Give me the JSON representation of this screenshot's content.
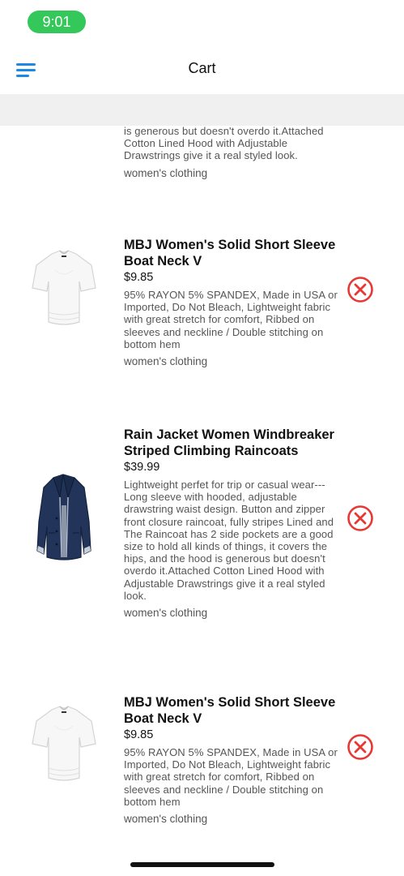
{
  "status_bar": {
    "time": "9:01"
  },
  "nav": {
    "title": "Cart",
    "menu_icon": "hamburger-icon"
  },
  "partial_item": {
    "description_tail": "is generous but doesn't overdo it.Attached Cotton Lined Hood with Adjustable Drawstrings give it a real styled look.",
    "category": "women's clothing"
  },
  "items": [
    {
      "name": "MBJ Women's Solid Short Sleeve Boat Neck V",
      "price": "$9.85",
      "description": "95% RAYON 5% SPANDEX, Made in USA or Imported, Do Not Bleach, Lightweight fabric with great stretch for comfort, Ribbed on sleeves and neckline / Double stitching on bottom hem",
      "category": "women's clothing",
      "image": "white-tshirt"
    },
    {
      "name": "Rain Jacket Women Windbreaker Striped Climbing Raincoats",
      "price": "$39.99",
      "description": "Lightweight perfet for trip or casual wear---Long sleeve with hooded, adjustable drawstring waist design. Button and zipper front closure raincoat, fully stripes Lined and The Raincoat has 2 side pockets are a good size to hold all kinds of things, it covers the hips, and the hood is generous but doesn't overdo it.Attached Cotton Lined Hood with Adjustable Drawstrings give it a real styled look.",
      "category": "women's clothing",
      "image": "navy-raincoat"
    },
    {
      "name": "MBJ Women's Solid Short Sleeve Boat Neck V",
      "price": "$9.85",
      "description": "95% RAYON 5% SPANDEX, Made in USA or Imported, Do Not Bleach, Lightweight fabric with great stretch for comfort, Ribbed on sleeves and neckline / Double stitching on bottom hem",
      "category": "women's clothing",
      "image": "white-tshirt"
    }
  ],
  "colors": {
    "accent": "#1e88e5",
    "remove": "#e53935",
    "status_pill": "#34c759",
    "band": "#f0f0f0"
  }
}
